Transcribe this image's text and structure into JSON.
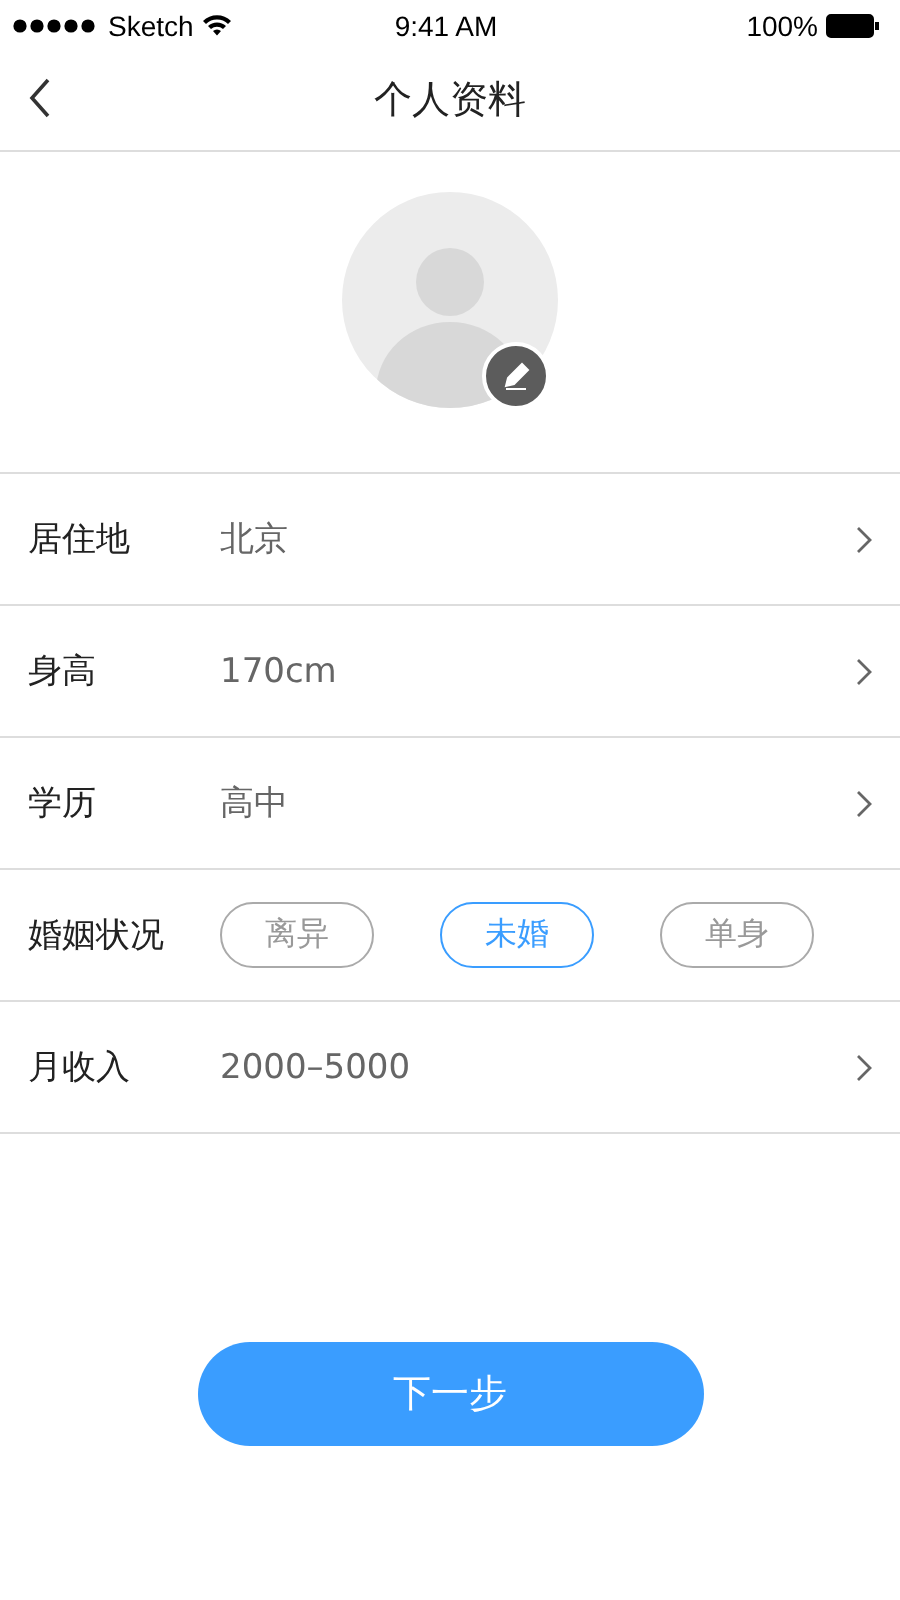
{
  "status_bar": {
    "carrier": "Sketch",
    "time": "9:41 AM",
    "battery": "100%"
  },
  "nav": {
    "title": "个人资料"
  },
  "rows": [
    {
      "kind": "select",
      "label": "居住地",
      "value": "北京"
    },
    {
      "kind": "select",
      "label": "身高",
      "value": "170cm"
    },
    {
      "kind": "select",
      "label": "学历",
      "value": "高中"
    },
    {
      "kind": "options",
      "label": "婚姻状况",
      "options": [
        {
          "label": "离异",
          "selected": false
        },
        {
          "label": "未婚",
          "selected": true
        },
        {
          "label": "单身",
          "selected": false
        }
      ]
    },
    {
      "kind": "select",
      "label": "月收入",
      "value": "2000–5000"
    }
  ],
  "next_button": "下一步"
}
